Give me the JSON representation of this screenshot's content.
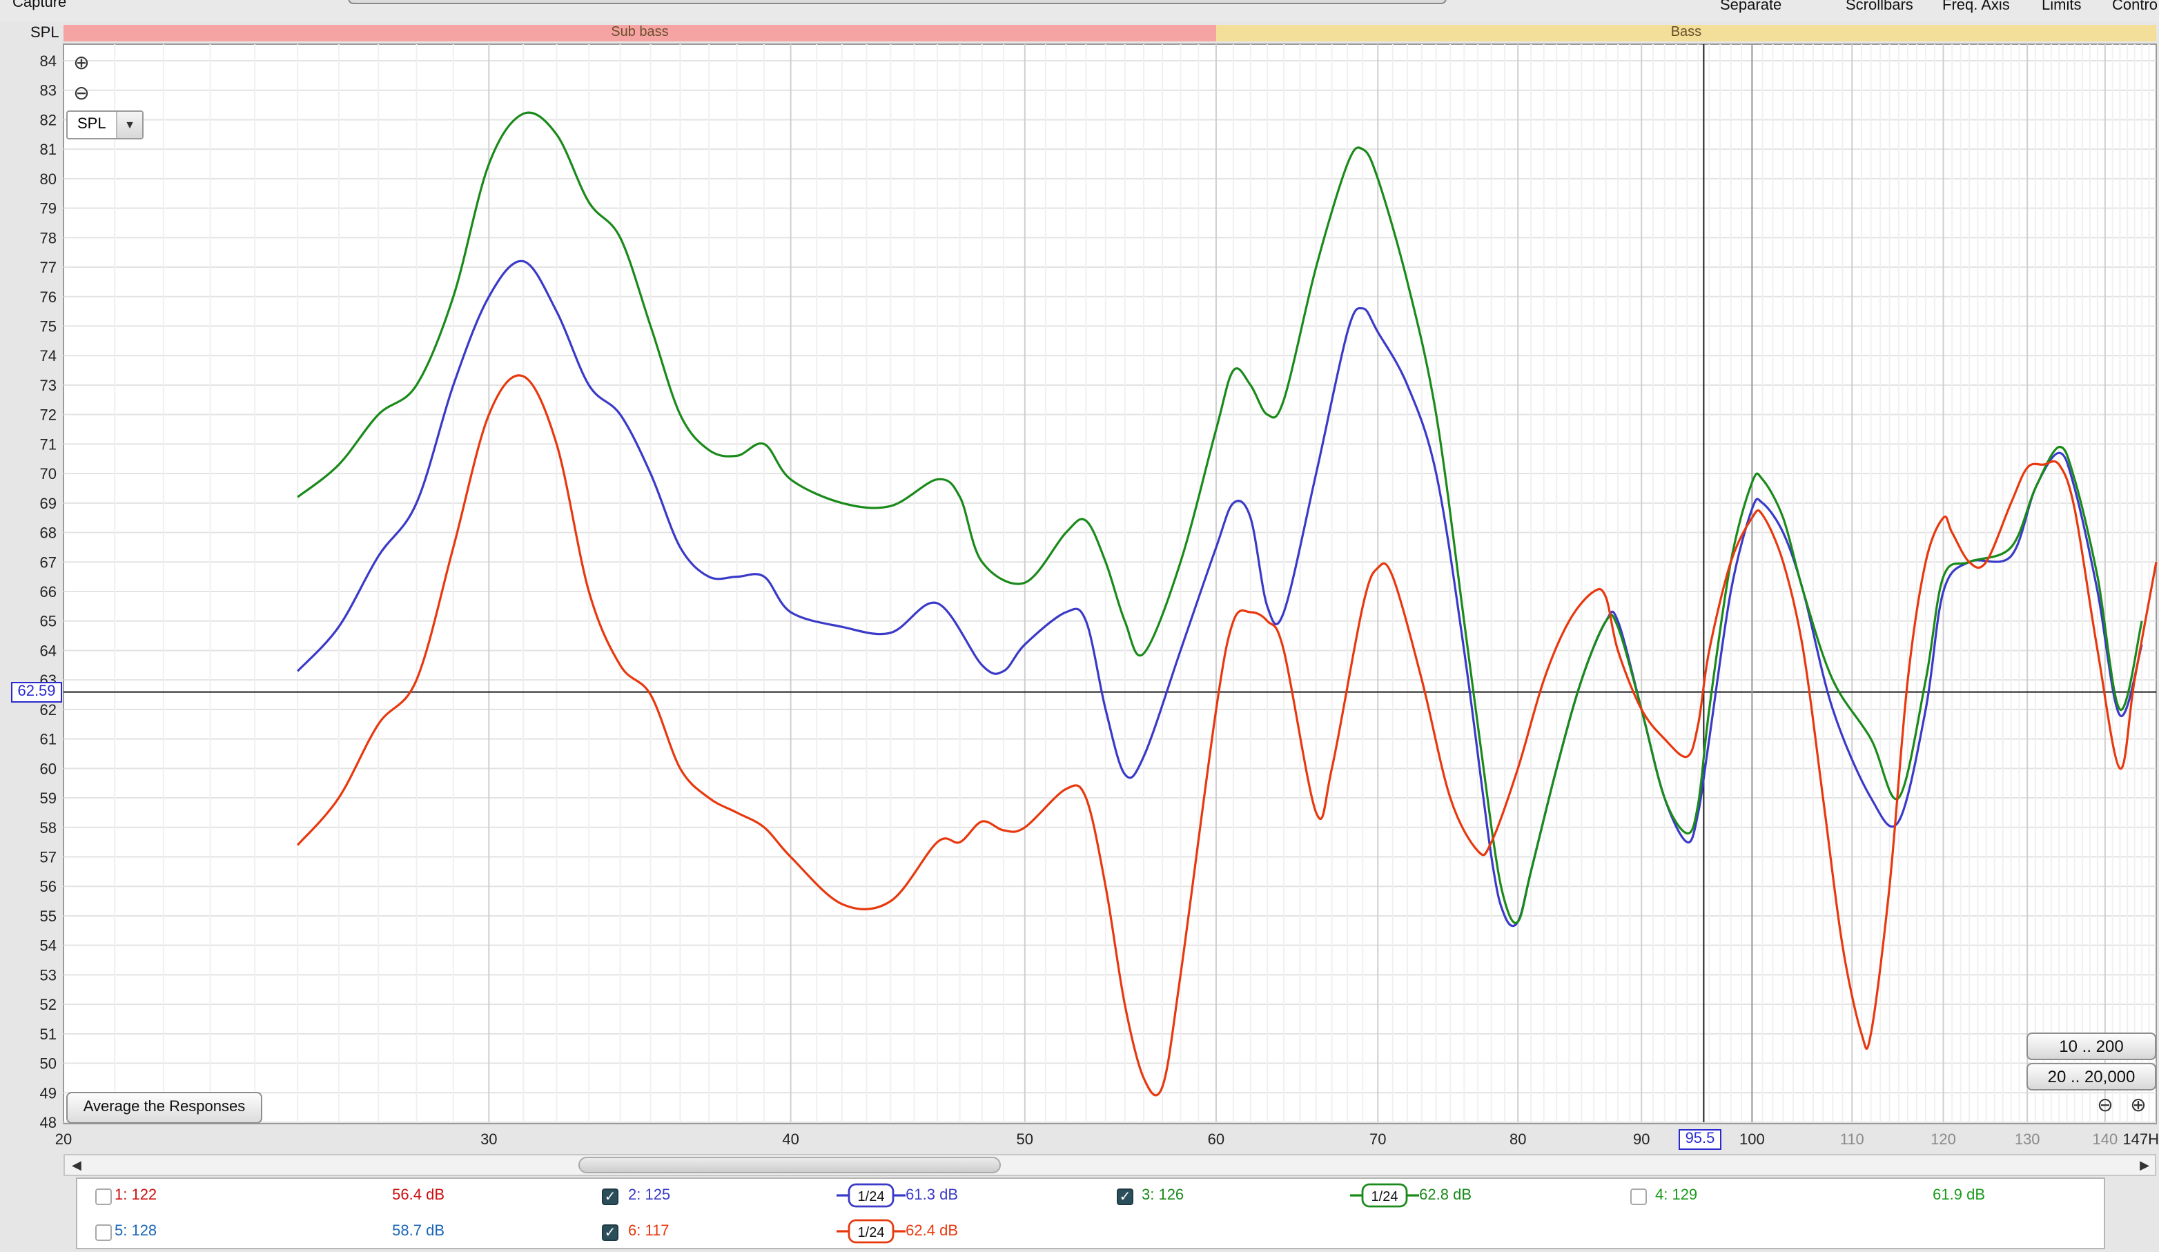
{
  "toolbar": {
    "capture": "Capture",
    "separate": "Separate",
    "scrollbars": "Scrollbars",
    "freq_axis": "Freq. Axis",
    "limits": "Limits",
    "controls": "Contro"
  },
  "bands": {
    "sub_bass": {
      "label": "Sub bass",
      "color": "#f5a3a3"
    },
    "bass": {
      "label": "Bass",
      "color": "#f3de9a"
    }
  },
  "y_axis_title": "SPL",
  "mode_select": {
    "value": "SPL"
  },
  "average_button": "Average the Responses",
  "range_buttons": {
    "narrow": "10 .. 200",
    "wide": "20 .. 20,000"
  },
  "cursor": {
    "y_readout": "62.59",
    "x_readout": "95.5",
    "y_value": 62.59,
    "x_value": 95.5
  },
  "chart_data": {
    "type": "line",
    "title": "",
    "xlabel": "",
    "ylabel": "SPL",
    "x_scale": "log",
    "xlim": [
      20,
      147
    ],
    "ylim": [
      48,
      84
    ],
    "grid": true,
    "y_ticks": [
      48,
      49,
      50,
      51,
      52,
      53,
      54,
      55,
      56,
      57,
      58,
      59,
      60,
      61,
      62,
      63,
      64,
      65,
      66,
      67,
      68,
      69,
      70,
      71,
      72,
      73,
      74,
      75,
      76,
      77,
      78,
      79,
      80,
      81,
      82,
      83,
      84
    ],
    "x_tick_labels": [
      "20",
      "30",
      "40",
      "50",
      "60",
      "70",
      "80",
      "90",
      "100",
      "110",
      "120",
      "130",
      "140",
      "147H"
    ],
    "x_tick_values": [
      20,
      30,
      40,
      50,
      60,
      70,
      80,
      90,
      100,
      110,
      120,
      130,
      140,
      147
    ],
    "x_tick_major": [
      true,
      true,
      true,
      true,
      true,
      true,
      true,
      true,
      true,
      false,
      false,
      false,
      false,
      true
    ],
    "series": [
      {
        "name": "2: 125",
        "color": "#3a3ac8",
        "points": [
          [
            25,
            63.3
          ],
          [
            26,
            64.8
          ],
          [
            27,
            67.2
          ],
          [
            28,
            69
          ],
          [
            29,
            73
          ],
          [
            30,
            76
          ],
          [
            31,
            77.2
          ],
          [
            32,
            75.5
          ],
          [
            33,
            73
          ],
          [
            34,
            72
          ],
          [
            35,
            70
          ],
          [
            36,
            67.5
          ],
          [
            37,
            66.5
          ],
          [
            38,
            66.5
          ],
          [
            39,
            66.5
          ],
          [
            40,
            65.3
          ],
          [
            42,
            64.8
          ],
          [
            44,
            64.6
          ],
          [
            46,
            65.6
          ],
          [
            48,
            63.5
          ],
          [
            49,
            63.3
          ],
          [
            50,
            64.2
          ],
          [
            52,
            65.3
          ],
          [
            53,
            65
          ],
          [
            54,
            62
          ],
          [
            55,
            59.8
          ],
          [
            56,
            60.4
          ],
          [
            58,
            64
          ],
          [
            60,
            67.5
          ],
          [
            61,
            69
          ],
          [
            62,
            68.5
          ],
          [
            63,
            65.5
          ],
          [
            64,
            65.3
          ],
          [
            66,
            70
          ],
          [
            68,
            74.8
          ],
          [
            69,
            75.6
          ],
          [
            70,
            74.8
          ],
          [
            72,
            73
          ],
          [
            74,
            70
          ],
          [
            76,
            64
          ],
          [
            78,
            57
          ],
          [
            79,
            55
          ],
          [
            80,
            54.8
          ],
          [
            81,
            56.5
          ],
          [
            83,
            60
          ],
          [
            85,
            63
          ],
          [
            87,
            65
          ],
          [
            88,
            65
          ],
          [
            90,
            62
          ],
          [
            92,
            59
          ],
          [
            94,
            57.5
          ],
          [
            95,
            58.5
          ],
          [
            96,
            61
          ],
          [
            98,
            66
          ],
          [
            100,
            68.8
          ],
          [
            101,
            69
          ],
          [
            103,
            68
          ],
          [
            105,
            66
          ],
          [
            108,
            62
          ],
          [
            112,
            59
          ],
          [
            115,
            58.2
          ],
          [
            118,
            62
          ],
          [
            120,
            66
          ],
          [
            123,
            67
          ],
          [
            128,
            67.2
          ],
          [
            131,
            69.5
          ],
          [
            134,
            70.7
          ],
          [
            136,
            69.5
          ],
          [
            139,
            66
          ],
          [
            142,
            61.8
          ],
          [
            145,
            64.2
          ]
        ]
      },
      {
        "name": "3: 126",
        "color": "#1a8a1a",
        "points": [
          [
            25,
            69.2
          ],
          [
            26,
            70.3
          ],
          [
            27,
            72
          ],
          [
            28,
            73
          ],
          [
            29,
            76
          ],
          [
            30,
            80.5
          ],
          [
            31,
            82.2
          ],
          [
            32,
            81.5
          ],
          [
            33,
            79.2
          ],
          [
            34,
            78
          ],
          [
            35,
            75
          ],
          [
            36,
            72
          ],
          [
            37,
            70.8
          ],
          [
            38,
            70.6
          ],
          [
            39,
            71
          ],
          [
            40,
            69.8
          ],
          [
            42,
            69
          ],
          [
            44,
            68.9
          ],
          [
            46,
            69.8
          ],
          [
            47,
            69.2
          ],
          [
            48,
            67
          ],
          [
            50,
            66.3
          ],
          [
            52,
            68
          ],
          [
            53,
            68.4
          ],
          [
            54,
            67
          ],
          [
            55,
            65
          ],
          [
            56,
            63.9
          ],
          [
            58,
            67
          ],
          [
            60,
            71.5
          ],
          [
            61,
            73.5
          ],
          [
            62,
            73
          ],
          [
            63,
            72
          ],
          [
            64,
            72.5
          ],
          [
            66,
            77
          ],
          [
            68,
            80.5
          ],
          [
            69,
            81
          ],
          [
            70,
            80
          ],
          [
            72,
            76.5
          ],
          [
            74,
            72
          ],
          [
            76,
            65
          ],
          [
            78,
            58
          ],
          [
            79,
            55.5
          ],
          [
            80,
            54.8
          ],
          [
            81,
            56.5
          ],
          [
            83,
            60
          ],
          [
            85,
            63
          ],
          [
            87,
            65
          ],
          [
            88,
            64.8
          ],
          [
            90,
            62
          ],
          [
            92,
            59
          ],
          [
            94,
            57.8
          ],
          [
            95,
            58.8
          ],
          [
            96,
            62
          ],
          [
            98,
            67
          ],
          [
            100,
            69.7
          ],
          [
            101,
            69.8
          ],
          [
            103,
            68.5
          ],
          [
            105,
            66
          ],
          [
            108,
            63
          ],
          [
            112,
            61
          ],
          [
            115,
            59
          ],
          [
            118,
            63
          ],
          [
            120,
            66.5
          ],
          [
            123,
            67
          ],
          [
            128,
            67.5
          ],
          [
            131,
            69.5
          ],
          [
            134,
            70.9
          ],
          [
            136,
            69.8
          ],
          [
            139,
            66.5
          ],
          [
            142,
            62
          ],
          [
            145,
            65
          ]
        ]
      },
      {
        "name": "6: 117",
        "color": "#e8380e",
        "points": [
          [
            25,
            57.4
          ],
          [
            26,
            59
          ],
          [
            27,
            61.5
          ],
          [
            28,
            63
          ],
          [
            29,
            67.5
          ],
          [
            30,
            72
          ],
          [
            31,
            73.3
          ],
          [
            32,
            71
          ],
          [
            33,
            66
          ],
          [
            34,
            63.5
          ],
          [
            35,
            62.5
          ],
          [
            36,
            60
          ],
          [
            37,
            59
          ],
          [
            38,
            58.5
          ],
          [
            39,
            58
          ],
          [
            40,
            57
          ],
          [
            42,
            55.4
          ],
          [
            44,
            55.5
          ],
          [
            46,
            57.5
          ],
          [
            47,
            57.5
          ],
          [
            48,
            58.2
          ],
          [
            49,
            57.9
          ],
          [
            50,
            58
          ],
          [
            52,
            59.3
          ],
          [
            53,
            59
          ],
          [
            54,
            56
          ],
          [
            55,
            52
          ],
          [
            56,
            49.5
          ],
          [
            57,
            49.2
          ],
          [
            58,
            53
          ],
          [
            60,
            62
          ],
          [
            61,
            65
          ],
          [
            62,
            65.3
          ],
          [
            63,
            65
          ],
          [
            64,
            64
          ],
          [
            66,
            58.5
          ],
          [
            67,
            60
          ],
          [
            69,
            65.5
          ],
          [
            70,
            66.8
          ],
          [
            71,
            66.5
          ],
          [
            73,
            63
          ],
          [
            75,
            59
          ],
          [
            77,
            57.2
          ],
          [
            78,
            57.5
          ],
          [
            80,
            60
          ],
          [
            82,
            63
          ],
          [
            84,
            65
          ],
          [
            86,
            66
          ],
          [
            87,
            65.8
          ],
          [
            88,
            64
          ],
          [
            90,
            62
          ],
          [
            92,
            61
          ],
          [
            94,
            60.4
          ],
          [
            95,
            61.5
          ],
          [
            96,
            64
          ],
          [
            98,
            67
          ],
          [
            100,
            68.5
          ],
          [
            101,
            68.6
          ],
          [
            103,
            67
          ],
          [
            105,
            64
          ],
          [
            107,
            59
          ],
          [
            109,
            54
          ],
          [
            111,
            51
          ],
          [
            112,
            51
          ],
          [
            114,
            56
          ],
          [
            116,
            63
          ],
          [
            118,
            67
          ],
          [
            120,
            68.5
          ],
          [
            121,
            68
          ],
          [
            123,
            67
          ],
          [
            125,
            67
          ],
          [
            128,
            69
          ],
          [
            130,
            70.2
          ],
          [
            132,
            70.3
          ],
          [
            134,
            70.3
          ],
          [
            136,
            68.8
          ],
          [
            139,
            64
          ],
          [
            142,
            60
          ],
          [
            144,
            63
          ],
          [
            147,
            67
          ]
        ]
      }
    ]
  },
  "legend": {
    "items": [
      {
        "name": "1: 122",
        "value": "56.4 dB",
        "checked": false,
        "color": "#cc1111",
        "smoothing": ""
      },
      {
        "name": "2: 125",
        "value": "61.3 dB",
        "checked": true,
        "color": "#3a3ac8",
        "smoothing": "1/24"
      },
      {
        "name": "3: 126",
        "value": "62.8 dB",
        "checked": true,
        "color": "#1a8a1a",
        "smoothing": "1/24"
      },
      {
        "name": "4: 129",
        "value": "61.9 dB",
        "checked": false,
        "color": "#1a9a1a",
        "smoothing": ""
      },
      {
        "name": "5: 128",
        "value": "58.7 dB",
        "checked": false,
        "color": "#1a66b8",
        "smoothing": ""
      },
      {
        "name": "6: 117",
        "value": "62.4 dB",
        "checked": true,
        "color": "#e8380e",
        "smoothing": "1/24"
      }
    ]
  }
}
